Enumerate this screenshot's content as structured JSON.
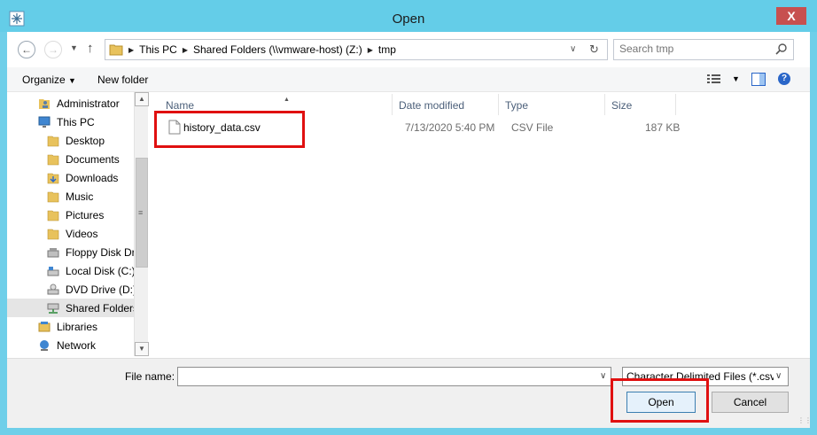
{
  "window": {
    "title": "Open",
    "close_symbol": "X"
  },
  "address": {
    "crumbs": [
      "This PC",
      "Shared Folders (\\\\vmware-host) (Z:)",
      "tmp"
    ],
    "search_placeholder": "Search tmp"
  },
  "toolbar": {
    "organize_label": "Organize",
    "new_folder_label": "New folder",
    "help_symbol": "?"
  },
  "nav": {
    "items": [
      {
        "label": "Administrator",
        "icon": "user-folder-icon"
      },
      {
        "label": "This PC",
        "icon": "computer-icon"
      },
      {
        "label": "Desktop",
        "icon": "folder-icon"
      },
      {
        "label": "Documents",
        "icon": "folder-icon"
      },
      {
        "label": "Downloads",
        "icon": "folder-icon"
      },
      {
        "label": "Music",
        "icon": "folder-icon"
      },
      {
        "label": "Pictures",
        "icon": "folder-icon"
      },
      {
        "label": "Videos",
        "icon": "folder-icon"
      },
      {
        "label": "Floppy Disk Dri",
        "icon": "floppy-icon"
      },
      {
        "label": "Local Disk (C:)",
        "icon": "disk-icon"
      },
      {
        "label": "DVD Drive (D:)",
        "icon": "dvd-icon"
      },
      {
        "label": "Shared Folders",
        "icon": "network-drive-icon",
        "selected": true
      },
      {
        "label": "Libraries",
        "icon": "libraries-icon"
      },
      {
        "label": "Network",
        "icon": "network-icon"
      }
    ]
  },
  "columns": {
    "name": "Name",
    "date_modified": "Date modified",
    "type": "Type",
    "size": "Size"
  },
  "files": [
    {
      "name": "history_data.csv",
      "date_modified": "7/13/2020 5:40 PM",
      "type": "CSV File",
      "size": "187 KB"
    }
  ],
  "bottom": {
    "file_name_label": "File name:",
    "file_name_value": "",
    "filter_selected": "Character Delimited Files (*.csv)",
    "open_label": "Open",
    "cancel_label": "Cancel"
  },
  "colors": {
    "titlebar": "#64cde8",
    "highlight_box": "#e01010",
    "close_button": "#c7504f"
  }
}
